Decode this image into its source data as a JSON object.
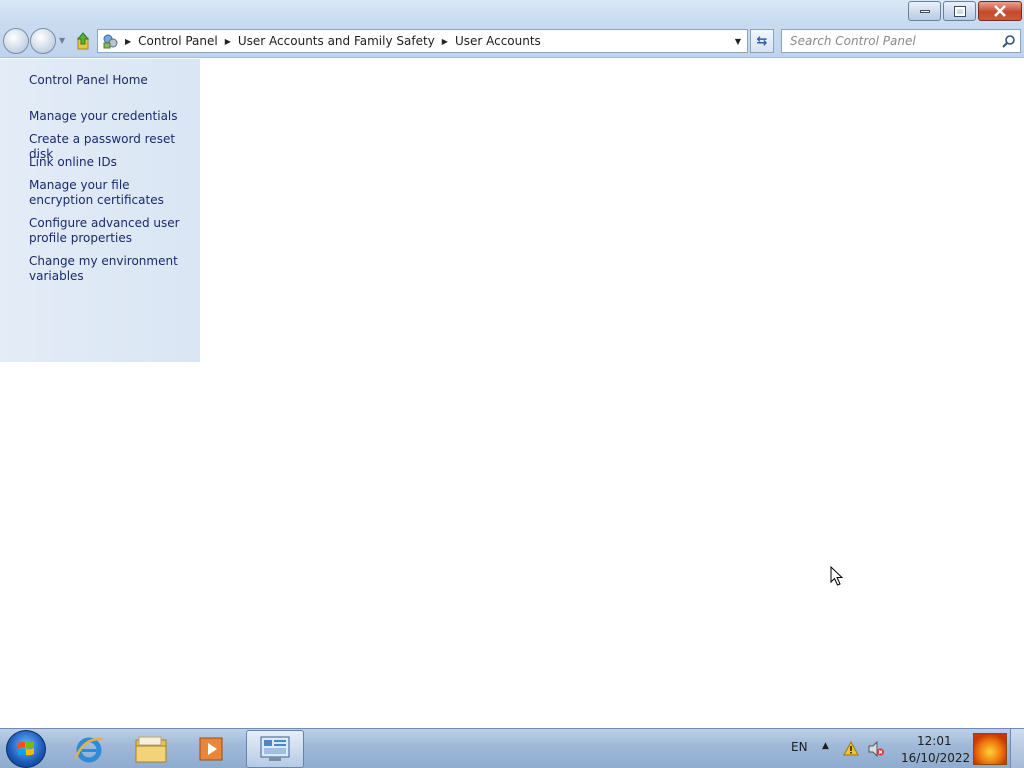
{
  "window": {
    "caption_buttons": [
      "minimize",
      "restore",
      "close"
    ]
  },
  "navigation": {
    "breadcrumbs": [
      "Control Panel",
      "User Accounts and Family Safety",
      "User Accounts"
    ],
    "search_placeholder": "Search Control Panel"
  },
  "sidebar": {
    "items": [
      {
        "label": "Control Panel Home"
      },
      {
        "label": "Manage your credentials"
      },
      {
        "label": "Create a password reset disk"
      },
      {
        "label": "Link online IDs"
      },
      {
        "label": "Manage your file encryption certificates"
      },
      {
        "label": "Configure advanced user profile properties"
      },
      {
        "label": "Change my environment variables"
      }
    ]
  },
  "taskbar": {
    "pinned": [
      "windows-start",
      "internet-explorer",
      "windows-explorer",
      "media-player",
      "control-panel"
    ],
    "language": "EN",
    "clock_time": "12:01",
    "clock_date": "16/10/2022"
  },
  "colors": {
    "sidebar_bg": "#dde8f5",
    "link": "#1a2a6b",
    "taskbar": "#9fb8d8"
  }
}
